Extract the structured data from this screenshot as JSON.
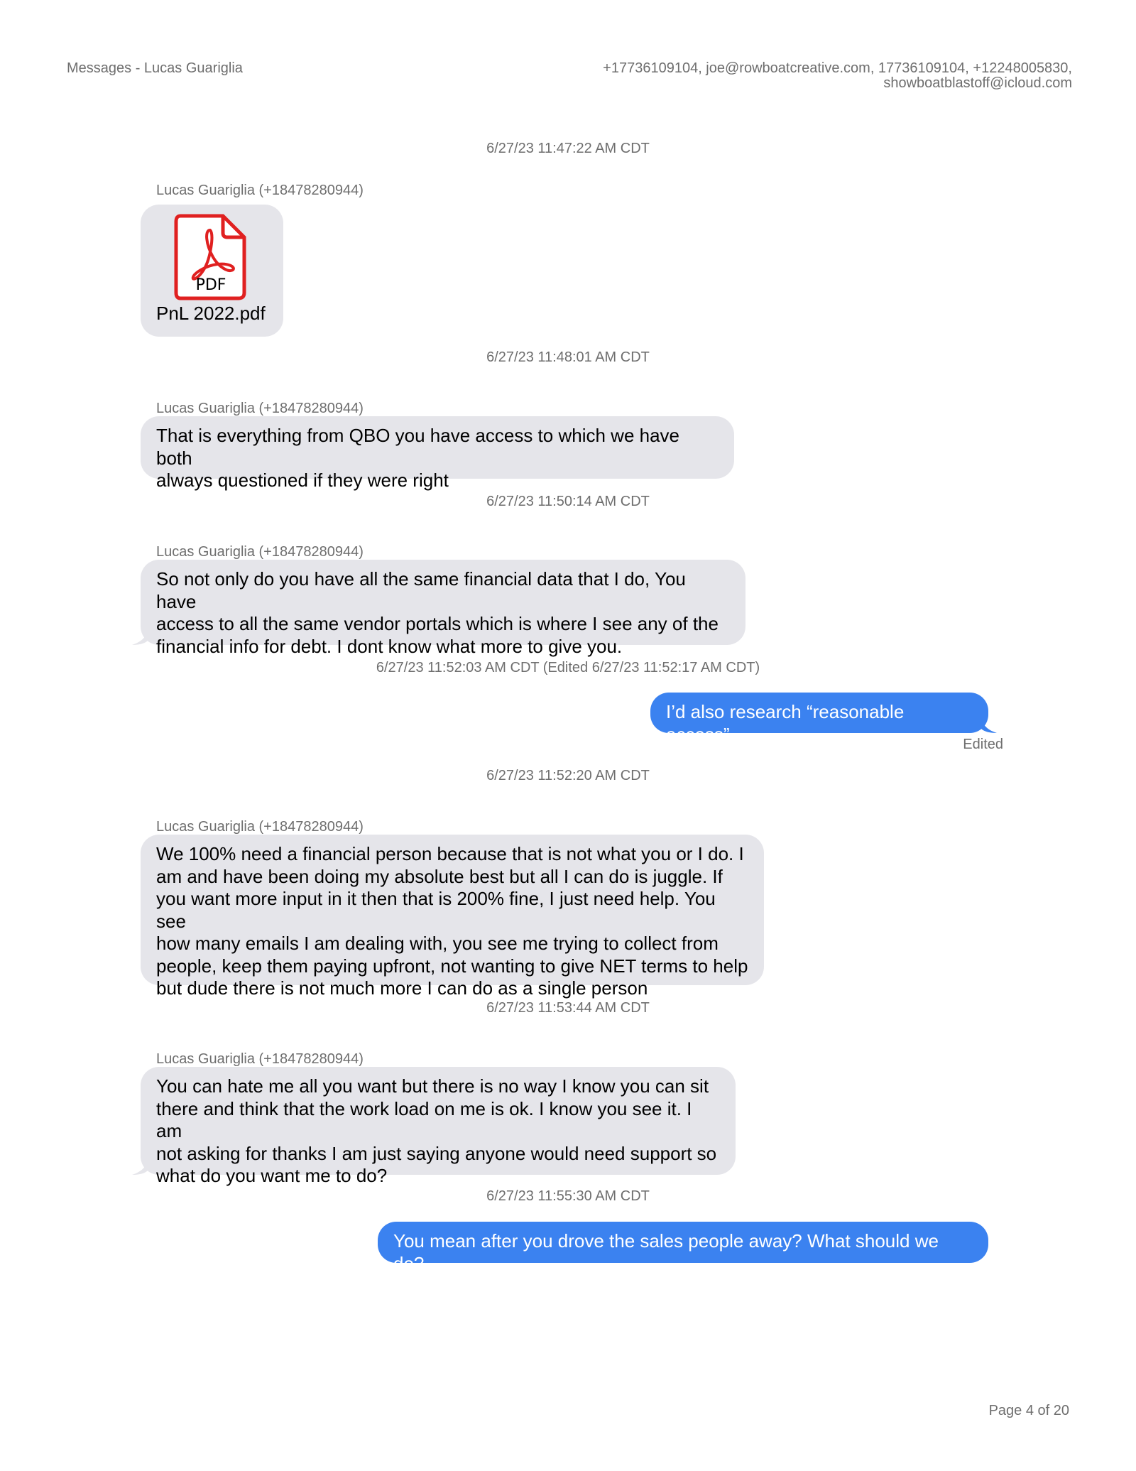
{
  "header": {
    "title": "Messages - Lucas Guariglia",
    "participants_line1": "+17736109104, joe@rowboatcreative.com, 17736109104, +12248005830,",
    "participants_line2": "showboatblastoff@icloud.com"
  },
  "messages": [
    {
      "timestamp": "6/27/23 11:47:22 AM CDT",
      "sender": "Lucas Guariglia (+18478280944)",
      "attachment": {
        "icon": "pdf-icon",
        "icon_label": "PDF",
        "filename": "PnL 2022.pdf"
      }
    },
    {
      "timestamp": "6/27/23 11:48:01 AM CDT",
      "sender": "Lucas Guariglia (+18478280944)",
      "lines": [
        "That is everything from QBO you have access to which we have both",
        "always questioned if they were right"
      ]
    },
    {
      "timestamp": "6/27/23 11:50:14 AM CDT",
      "sender": "Lucas Guariglia (+18478280944)",
      "lines": [
        "So not only do you have all the same financial data that I do, You have",
        "access to all the same vendor portals which is where I see any of the",
        "financial info for debt. I dont know what more to give you."
      ]
    },
    {
      "timestamp": "6/27/23 11:52:03 AM CDT (Edited 6/27/23 11:52:17 AM CDT)",
      "text": "I’d also research “reasonable access”",
      "status": "Edited"
    },
    {
      "timestamp": "6/27/23 11:52:20 AM CDT",
      "sender": "Lucas Guariglia (+18478280944)",
      "lines": [
        "We 100% need a financial person because that is not what you or I do. I",
        "am and have been doing my absolute best but all I can do is juggle. If",
        "you want more input in it then that is 200% fine, I just need help. You see",
        "how many emails I am dealing with, you see me trying to collect from",
        "people, keep them paying upfront, not wanting to give NET terms to help",
        "but dude there is not much more I can do as a single person"
      ]
    },
    {
      "timestamp": "6/27/23 11:53:44 AM CDT",
      "sender": "Lucas Guariglia (+18478280944)",
      "lines": [
        "You can hate me all you want but there is no way I know you can sit",
        "there and think that the work load on me is ok. I know you see it. I am",
        "not asking for thanks I am just saying anyone would need support so",
        "what do you want me to do?"
      ]
    },
    {
      "timestamp": "6/27/23 11:55:30 AM CDT",
      "text": "You mean after you drove the sales people away? What should we do?"
    }
  ],
  "footer": {
    "page": "Page 4 of 20"
  },
  "colors": {
    "incoming_bubble": "#e5e5ea",
    "outgoing_bubble": "#3b82f0",
    "meta_text": "#6e6e6e",
    "pdf_red": "#e02020"
  }
}
